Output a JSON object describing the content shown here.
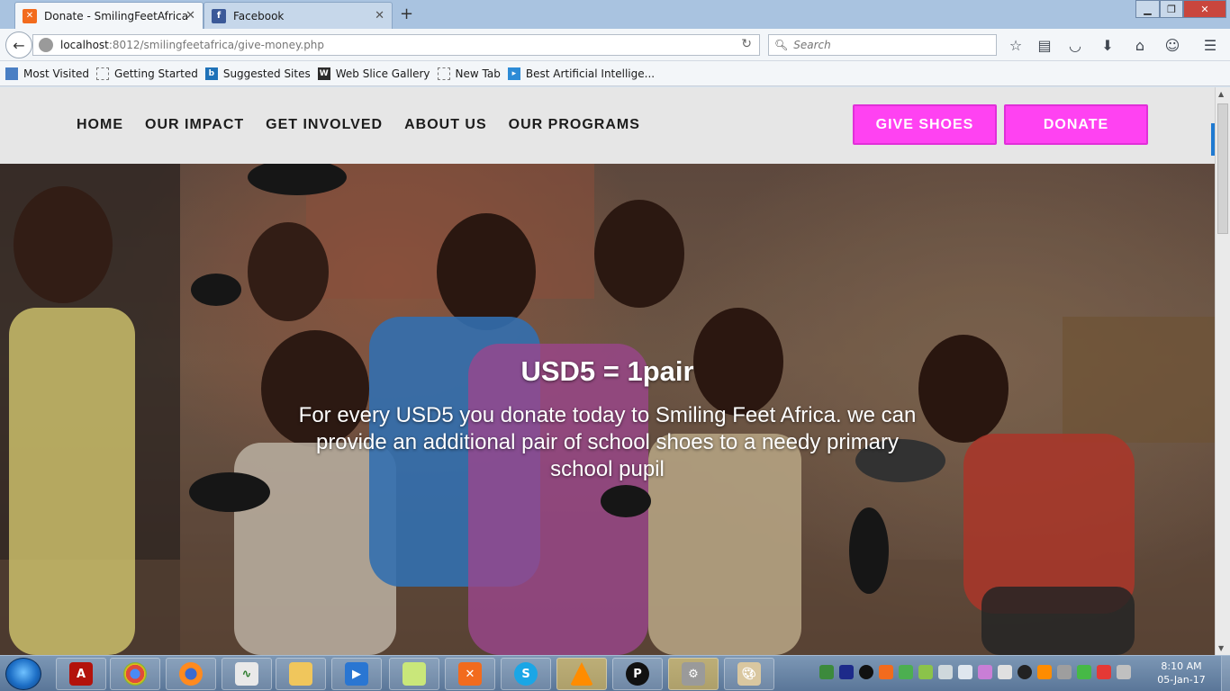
{
  "browser": {
    "tabs": [
      {
        "title": "Donate - SmilingFeetAfrica",
        "active": true,
        "favicon": "xampp-icon"
      },
      {
        "title": "Facebook",
        "active": false,
        "favicon": "facebook-icon"
      }
    ],
    "url": {
      "host": "localhost",
      "path": ":8012/smilingfeetafrica/give-money.php"
    },
    "search_placeholder": "Search",
    "bookmarks": [
      {
        "label": "Most Visited",
        "icon": "bookmark-star-icon"
      },
      {
        "label": "Getting Started",
        "icon": "page-icon"
      },
      {
        "label": "Suggested Sites",
        "icon": "bing-icon"
      },
      {
        "label": "Web Slice Gallery",
        "icon": "webslice-icon"
      },
      {
        "label": "New Tab",
        "icon": "page-icon"
      },
      {
        "label": "Best Artificial Intellige...",
        "icon": "site-icon"
      }
    ]
  },
  "site": {
    "menu": [
      "HOME",
      "OUR IMPACT",
      "GET INVOLVED",
      "ABOUT US",
      "OUR PROGRAMS"
    ],
    "buttons": {
      "give_shoes": "GIVE SHOES",
      "donate": "DONATE"
    },
    "accent": "#ff42f2"
  },
  "hero": {
    "title": "USD5 = 1pair",
    "subtitle": "For every USD5 you donate today to Smiling Feet Africa. we can provide an additional pair of school shoes to a needy primary school pupil"
  },
  "taskbar": {
    "apps": [
      "acrobat-icon",
      "chrome-icon",
      "firefox-icon",
      "task-manager-icon",
      "file-explorer-icon",
      "media-player-icon",
      "sticky-notes-icon",
      "xampp-icon",
      "skype-icon",
      "vlc-icon",
      "app-p-icon",
      "app-robot-icon",
      "paint-icon"
    ],
    "time": "8:10 AM",
    "date": "05-Jan-17"
  }
}
